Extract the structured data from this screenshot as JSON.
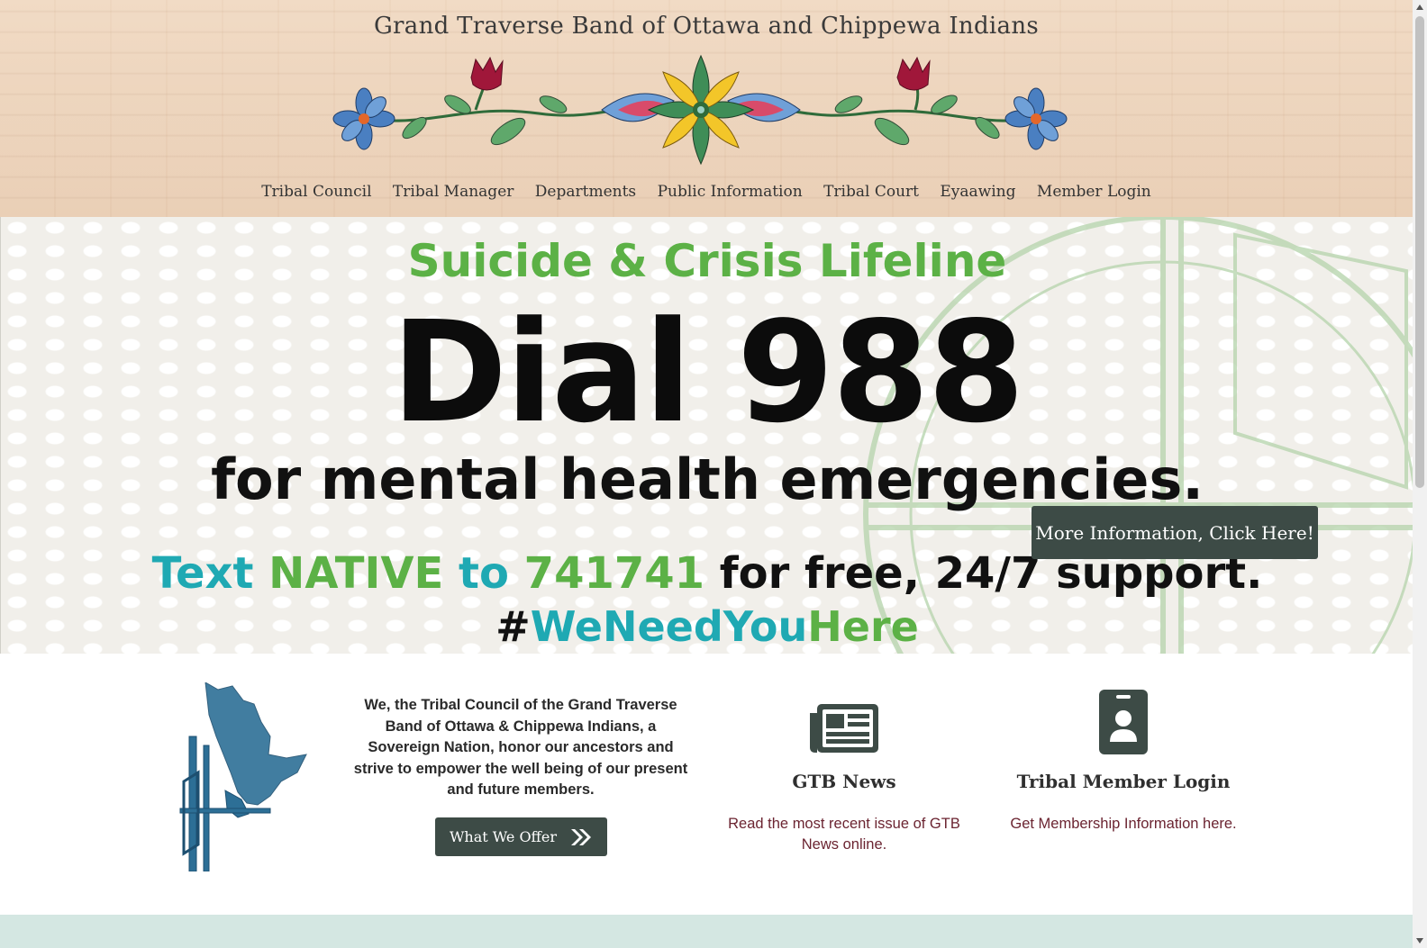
{
  "header": {
    "title": "Grand Traverse Band of Ottawa and Chippewa Indians",
    "nav": [
      {
        "label": "Tribal Council"
      },
      {
        "label": "Tribal Manager"
      },
      {
        "label": "Departments"
      },
      {
        "label": "Public Information"
      },
      {
        "label": "Tribal Court"
      },
      {
        "label": "Eyaawing"
      },
      {
        "label": "Member Login"
      }
    ]
  },
  "hero": {
    "lifeline": "Suicide & Crisis Lifeline",
    "dial": "Dial 988",
    "emergencies": "for mental health emergencies.",
    "text_prefix": "Text",
    "text_native": "NATIVE",
    "text_to": "to",
    "text_number": "741741",
    "text_suffix": "for free, 24/7 support.",
    "hashtag_hash": "#",
    "hashtag_we_need_you": "WeNeedYou",
    "hashtag_here": "Here",
    "button": "More Information, Click Here!"
  },
  "content": {
    "mission": "We, the Tribal Council of the Grand Traverse Band of Ottawa & Chippewa Indians, a Sovereign Nation, honor our ancestors and strive to empower the well being of our present and future members.",
    "offer_button": "What We Offer",
    "cards": [
      {
        "icon": "newspaper-icon",
        "title": "GTB News",
        "desc": "Read the most recent issue of GTB News online."
      },
      {
        "icon": "id-badge-icon",
        "title": "Tribal Member Login",
        "desc": "Get Membership Information here."
      }
    ]
  },
  "colors": {
    "header_bg": "#ecd3b9",
    "button_bg": "#3d4b46",
    "lifeline_green": "#5cb146",
    "hashtag_teal": "#1fa9b3",
    "link_maroon": "#6b2431",
    "bottom_band": "#d4e7e2"
  }
}
